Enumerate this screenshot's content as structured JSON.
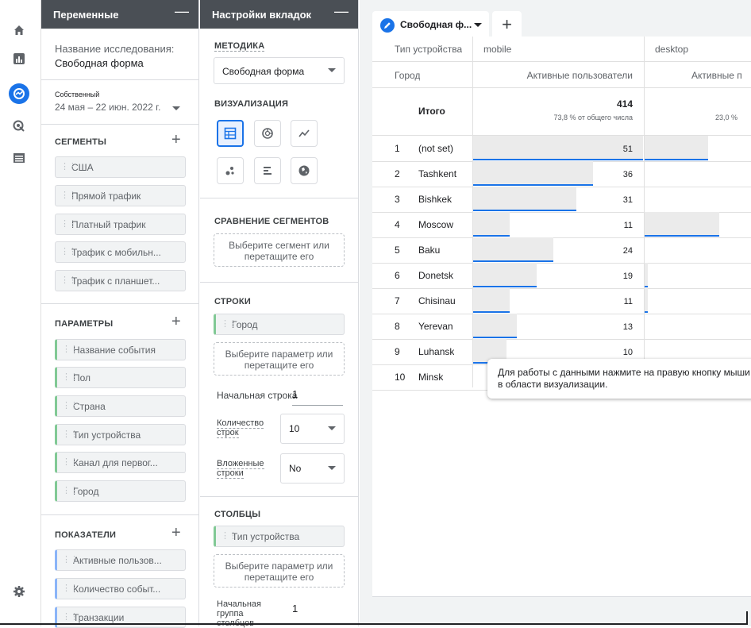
{
  "rail": {
    "icons": [
      "home-icon",
      "reports-icon",
      "explore-icon",
      "advertising-icon",
      "configure-icon",
      "settings-icon"
    ]
  },
  "variables": {
    "title": "Переменные",
    "exploration_label": "Название исследования:",
    "exploration_name": "Свободная форма",
    "range_label": "Собственный",
    "range_value": "24 мая – 22 июн. 2022 г.",
    "segments_title": "СЕГМЕНТЫ",
    "segments": [
      "США",
      "Прямой трафик",
      "Платный трафик",
      "Трафик с мобильн...",
      "Трафик с планшет..."
    ],
    "dimensions_title": "ПАРАМЕТРЫ",
    "dimensions": [
      "Название события",
      "Пол",
      "Страна",
      "Тип устройства",
      "Канал для первог...",
      "Город"
    ],
    "metrics_title": "ПОКАЗАТЕЛИ",
    "metrics": [
      "Активные пользов...",
      "Количество событ...",
      "Транзакции"
    ]
  },
  "tab_settings": {
    "title": "Настройки вкладок",
    "technique_label": "МЕТОДИКА",
    "technique_value": "Свободная форма",
    "viz_label": "ВИЗУАЛИЗАЦИЯ",
    "segment_compare_label": "СРАВНЕНИЕ СЕГМЕНТОВ",
    "segment_drop": "Выберите сегмент или перетащите его",
    "rows_label": "СТРОКИ",
    "rows_chip": "Город",
    "rows_drop": "Выберите параметр или перетащите его",
    "start_row_label": "Начальная строка",
    "start_row_value": "1",
    "row_count_label": "Количество строк",
    "row_count_value": "10",
    "nested_rows_label": "Вложенные строки",
    "nested_rows_value": "No",
    "columns_label": "СТОЛБЦЫ",
    "columns_chip": "Тип устройства",
    "columns_drop": "Выберите параметр или перетащите его",
    "start_col_group_label": "Начальная группа столбцов",
    "start_col_group_value": "1"
  },
  "canvas": {
    "tab_name": "Свободная ф...",
    "add_tab": "+",
    "header_device_label": "Тип устройства",
    "col_mobile": "mobile",
    "col_desktop": "desktop",
    "header_city_label": "Город",
    "metric_header_mobile": "Активные пользователи",
    "metric_header_desktop": "Активные п",
    "total_label": "Итого",
    "total_mobile": "414",
    "total_mobile_pct": "73,8 % от общего числа",
    "total_desktop_pct": "23,0 %",
    "rows": [
      {
        "rank": "1",
        "city": "(not set)",
        "mobile": "51"
      },
      {
        "rank": "2",
        "city": "Tashkent",
        "mobile": "36"
      },
      {
        "rank": "3",
        "city": "Bishkek",
        "mobile": "31"
      },
      {
        "rank": "4",
        "city": "Moscow",
        "mobile": "11"
      },
      {
        "rank": "5",
        "city": "Baku",
        "mobile": "24"
      },
      {
        "rank": "6",
        "city": "Donetsk",
        "mobile": "19"
      },
      {
        "rank": "7",
        "city": "Chisinau",
        "mobile": "11"
      },
      {
        "rank": "8",
        "city": "Yerevan",
        "mobile": "13"
      },
      {
        "rank": "9",
        "city": "Luhansk",
        "mobile": "10"
      },
      {
        "rank": "10",
        "city": "Minsk",
        "mobile": ""
      }
    ],
    "desktop_bar_fractions": [
      0.6,
      0,
      0,
      0.7,
      0,
      0.03,
      0.03,
      0,
      0,
      0
    ],
    "tooltip": "Для работы с данными нажмите на правую кнопку мыши в области визуализации."
  },
  "colors": {
    "accent": "#1a73e8",
    "panel_header": "#4a4f55",
    "dimension_marker": "#81c995",
    "metric_marker": "#8ab4f8"
  }
}
